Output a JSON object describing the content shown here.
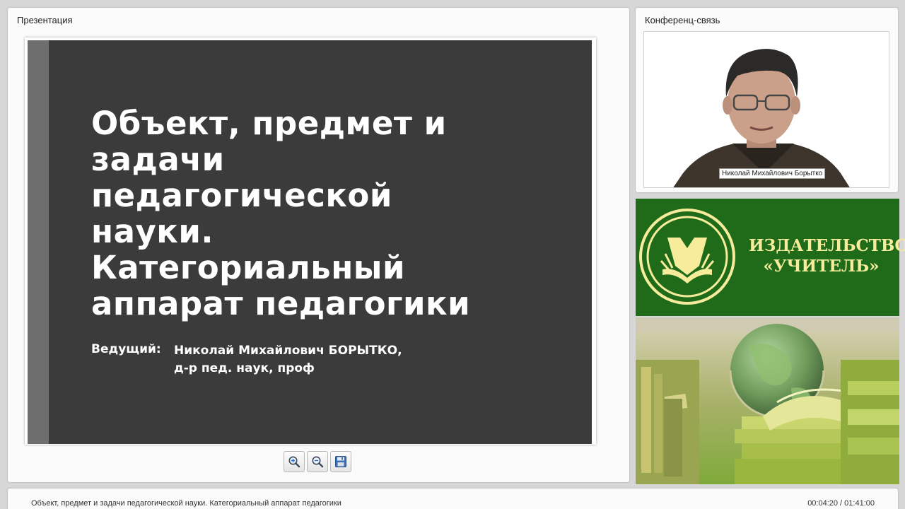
{
  "presentation": {
    "title": "Презентация",
    "slide": {
      "title_lines": [
        "Объект, предмет и",
        "задачи",
        "педагогической",
        "науки.",
        "Категориальный",
        "аппарат педагогики"
      ],
      "presenter_label": "Ведущий:",
      "presenter_lines": [
        "Николай Михайлович БОРЫТКО,",
        "д-р пед. наук, проф"
      ]
    },
    "toolbar": {
      "zoom_in_icon": "zoom-in-icon",
      "zoom_out_icon": "zoom-out-icon",
      "save_icon": "save-icon"
    }
  },
  "conference": {
    "title": "Конференц-связь",
    "speaker_name": "Николай Михайлович Борытко"
  },
  "publisher": {
    "lines": [
      "ИЗДАТЕЛЬСТВО",
      "«УЧИТЕЛЬ»"
    ],
    "colors": {
      "background": "#1f6b1a",
      "text": "#f6ec9c"
    }
  },
  "footer": {
    "lecture_title": "Объект, предмет и задачи педагогической науки. Категориальный аппарат педагогики",
    "time": "00:04:20 / 01:41:00"
  }
}
